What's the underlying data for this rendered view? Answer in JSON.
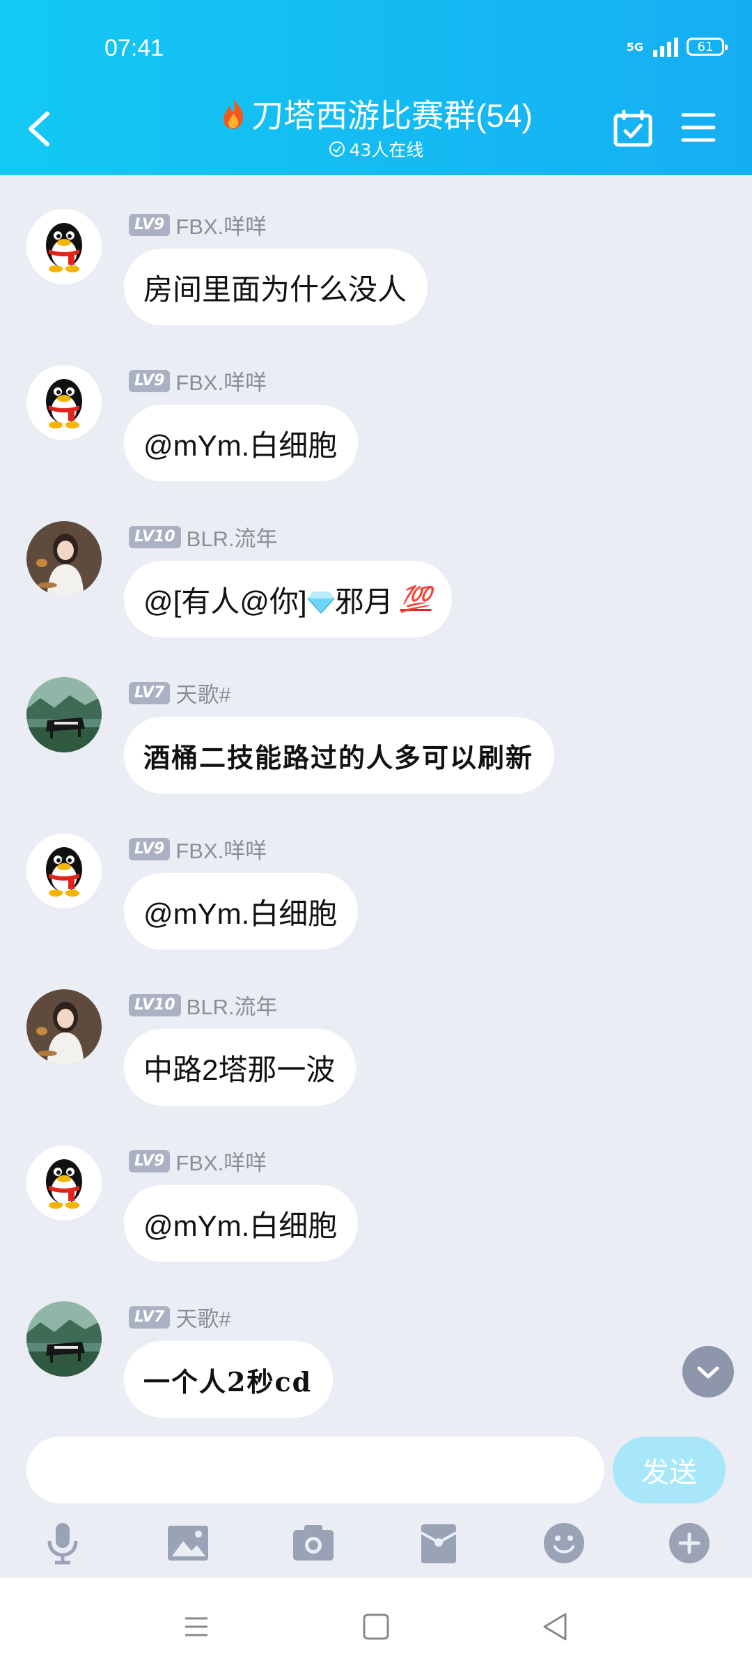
{
  "status": {
    "time": "07:41",
    "network": "5G",
    "battery": "61"
  },
  "header": {
    "title": "刀塔西游比赛群(54)",
    "online": "43人在线"
  },
  "messages": [
    {
      "level": "LV9",
      "name": "FBX.咩咩",
      "text": "房间里面为什么没人",
      "avatar": "penguin",
      "style": "normal"
    },
    {
      "level": "LV9",
      "name": "FBX.咩咩",
      "text": "@mYm.白细胞",
      "avatar": "penguin",
      "style": "normal"
    },
    {
      "level": "LV10",
      "name": "BLR.流年",
      "text_before": "@[有人@你]",
      "text_after": "邪月",
      "emoji": "💯",
      "avatar": "girl",
      "style": "normal"
    },
    {
      "level": "LV7",
      "name": "天歌#",
      "text": "酒桶二技能路过的人多可以刷新",
      "avatar": "piano",
      "style": "hand"
    },
    {
      "level": "LV9",
      "name": "FBX.咩咩",
      "text": "@mYm.白细胞",
      "avatar": "penguin",
      "style": "normal"
    },
    {
      "level": "LV10",
      "name": "BLR.流年",
      "text": "中路2塔那一波",
      "avatar": "girl",
      "style": "normal"
    },
    {
      "level": "LV9",
      "name": "FBX.咩咩",
      "text": "@mYm.白细胞",
      "avatar": "penguin",
      "style": "normal"
    },
    {
      "level": "LV7",
      "name": "天歌#",
      "text": "一个人2秒cd",
      "avatar": "piano",
      "style": "hand"
    }
  ],
  "input": {
    "placeholder": "",
    "send_label": "发送"
  },
  "toolbar_icons": [
    "microphone-icon",
    "image-icon",
    "camera-icon",
    "red-packet-icon",
    "emoji-icon",
    "plus-icon"
  ],
  "colors": {
    "header": "#16aef2",
    "chat_bg": "#eaedf4",
    "send_disabled": "#a7e7f9"
  }
}
